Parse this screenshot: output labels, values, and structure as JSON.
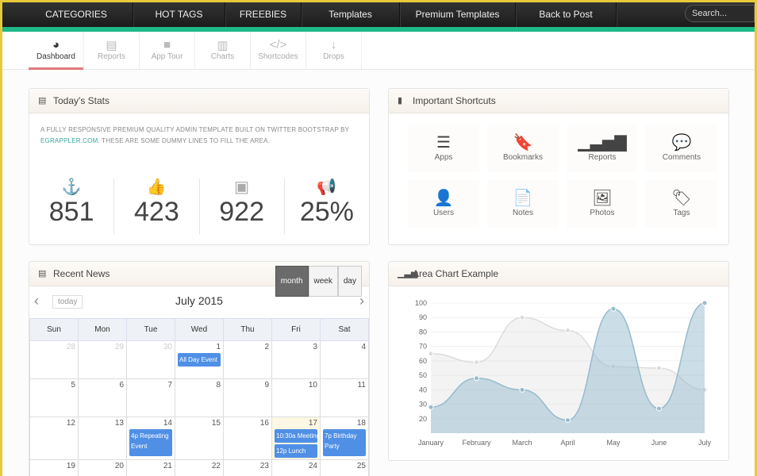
{
  "topnav": {
    "items": [
      "CATEGORIES",
      "HOT TAGS",
      "FREEBIES",
      "Templates",
      "Premium Templates",
      "Back to Post"
    ],
    "search_placeholder": "Search..."
  },
  "subnav": {
    "tabs": [
      {
        "label": "Dashboard",
        "icon": "dashboard-icon",
        "glyph": "◕",
        "active": true
      },
      {
        "label": "Reports",
        "icon": "reports-icon",
        "glyph": "▤"
      },
      {
        "label": "App Tour",
        "icon": "video-icon",
        "glyph": "■"
      },
      {
        "label": "Charts",
        "icon": "bar-chart-icon",
        "glyph": "▥"
      },
      {
        "label": "Shortcodes",
        "icon": "code-icon",
        "glyph": "</>"
      },
      {
        "label": "Drops",
        "icon": "arrow-down-icon",
        "glyph": "↓"
      }
    ]
  },
  "stats": {
    "title": "Today's Stats",
    "desc_pre": "A FULLY RESPONSIVE PREMIUM QUALITY ADMIN TEMPLATE BUILT ON TWITTER BOOTSTRAP BY ",
    "link": "EGRAPPLER.COM",
    "desc_post": ". THESE ARE SOME DUMMY LINES TO FILL THE AREA.",
    "items": [
      {
        "icon": "anchor-icon",
        "glyph": "⚓",
        "value": "851"
      },
      {
        "icon": "thumbs-up-icon",
        "glyph": "👍",
        "value": "423"
      },
      {
        "icon": "twitter-icon",
        "glyph": "▣",
        "value": "922"
      },
      {
        "icon": "megaphone-icon",
        "glyph": "📢",
        "value": "25%"
      }
    ]
  },
  "shortcuts": {
    "title": "Important Shortcuts",
    "items": [
      {
        "label": "Apps",
        "icon": "list-icon",
        "glyph": "☰"
      },
      {
        "label": "Bookmarks",
        "icon": "bookmark-icon",
        "glyph": "🔖"
      },
      {
        "label": "Reports",
        "icon": "signal-icon",
        "glyph": "▁▃▅▇"
      },
      {
        "label": "Comments",
        "icon": "comment-icon",
        "glyph": "💬"
      },
      {
        "label": "Users",
        "icon": "user-icon",
        "glyph": "👤"
      },
      {
        "label": "Notes",
        "icon": "file-icon",
        "glyph": "📄"
      },
      {
        "label": "Photos",
        "icon": "picture-icon",
        "glyph": "🖼"
      },
      {
        "label": "Tags",
        "icon": "tag-icon",
        "glyph": "🏷"
      }
    ]
  },
  "news": {
    "title": "Recent News",
    "views": [
      "month",
      "week",
      "day"
    ],
    "active_view": "month",
    "today": "today",
    "month": "July 2015",
    "days": [
      "Sun",
      "Mon",
      "Tue",
      "Wed",
      "Thu",
      "Fri",
      "Sat"
    ],
    "weeks": [
      [
        {
          "d": "28",
          "o": true
        },
        {
          "d": "29",
          "o": true
        },
        {
          "d": "30",
          "o": true
        },
        {
          "d": "1",
          "ev": [
            "All Day Event"
          ]
        },
        {
          "d": "2"
        },
        {
          "d": "3"
        },
        {
          "d": "4"
        }
      ],
      [
        {
          "d": "5"
        },
        {
          "d": "6"
        },
        {
          "d": "7"
        },
        {
          "d": "8"
        },
        {
          "d": "9"
        },
        {
          "d": "10"
        },
        {
          "d": "11"
        }
      ],
      [
        {
          "d": "12"
        },
        {
          "d": "13"
        },
        {
          "d": "14",
          "ev": [
            "4p Repeating Event"
          ],
          "tall": true
        },
        {
          "d": "15"
        },
        {
          "d": "16"
        },
        {
          "d": "17",
          "hl": true,
          "ev": [
            "10:30a Meeting",
            "12p Lunch"
          ]
        },
        {
          "d": "18",
          "ev": [
            "7p Birthday Party"
          ],
          "tall": true
        }
      ],
      [
        {
          "d": "19"
        },
        {
          "d": "20"
        },
        {
          "d": "21"
        },
        {
          "d": "22"
        },
        {
          "d": "23"
        },
        {
          "d": "24"
        },
        {
          "d": "25"
        }
      ]
    ]
  },
  "chart_panel": {
    "title": "Area Chart Example"
  },
  "chart_data": {
    "type": "area",
    "categories": [
      "January",
      "February",
      "March",
      "April",
      "May",
      "June",
      "July"
    ],
    "series": [
      {
        "values": [
          65,
          59,
          90,
          81,
          56,
          55,
          40
        ],
        "color": "#dcdcdc"
      },
      {
        "values": [
          28,
          48,
          40,
          19,
          96,
          27,
          100
        ],
        "color": "#97bbcd"
      }
    ],
    "yticks": [
      20,
      30,
      40,
      50,
      60,
      70,
      80,
      90,
      100
    ],
    "ylim": [
      10,
      100
    ],
    "grid": true
  }
}
